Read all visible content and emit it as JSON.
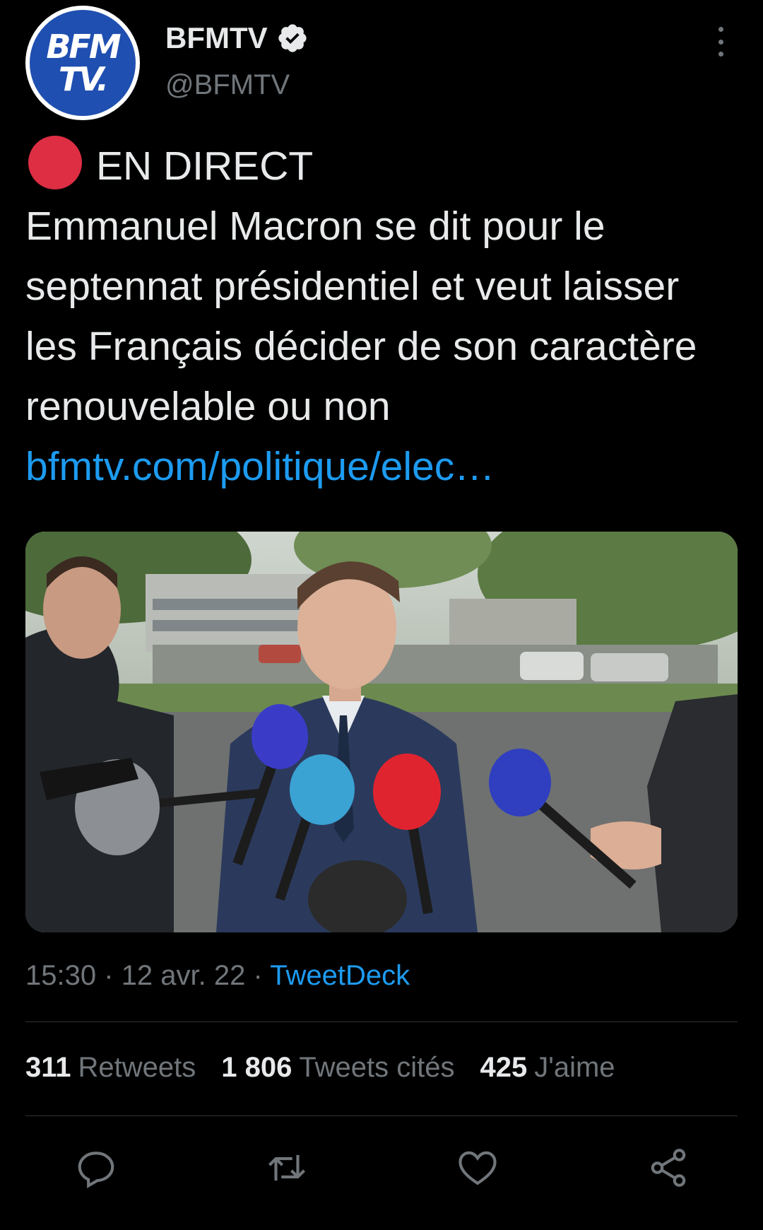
{
  "author": {
    "display_name": "BFMTV",
    "handle": "@BFMTV",
    "verified": true,
    "avatar_line1": "BFM",
    "avatar_line2": "TV.",
    "icons": {
      "verified": "verified-badge-icon",
      "more": "more-vertical-icon"
    }
  },
  "tweet": {
    "live_label": "EN DIRECT",
    "text": "Emmanuel Macron se dit pour le septennat présidentiel et veut laisser les Français décider de son caractère renouvelable ou non",
    "link": "bfmtv.com/politique/elec…",
    "time": "15:30",
    "date": "12 avr. 22",
    "separator": "·",
    "source": "TweetDeck"
  },
  "stats": {
    "retweets_count": "311",
    "retweets_label": "Retweets",
    "quotes_count": "1 806",
    "quotes_label": "Tweets cités",
    "likes_count": "425",
    "likes_label": "J'aime"
  },
  "actions": {
    "reply": "reply-icon",
    "retweet": "retweet-icon",
    "like": "heart-icon",
    "share": "share-icon"
  },
  "colors": {
    "background": "#000000",
    "text": "#e7e9ea",
    "secondary": "#71767b",
    "link": "#1d9bf0",
    "live": "#dd2e44",
    "divider": "#2f3336"
  }
}
